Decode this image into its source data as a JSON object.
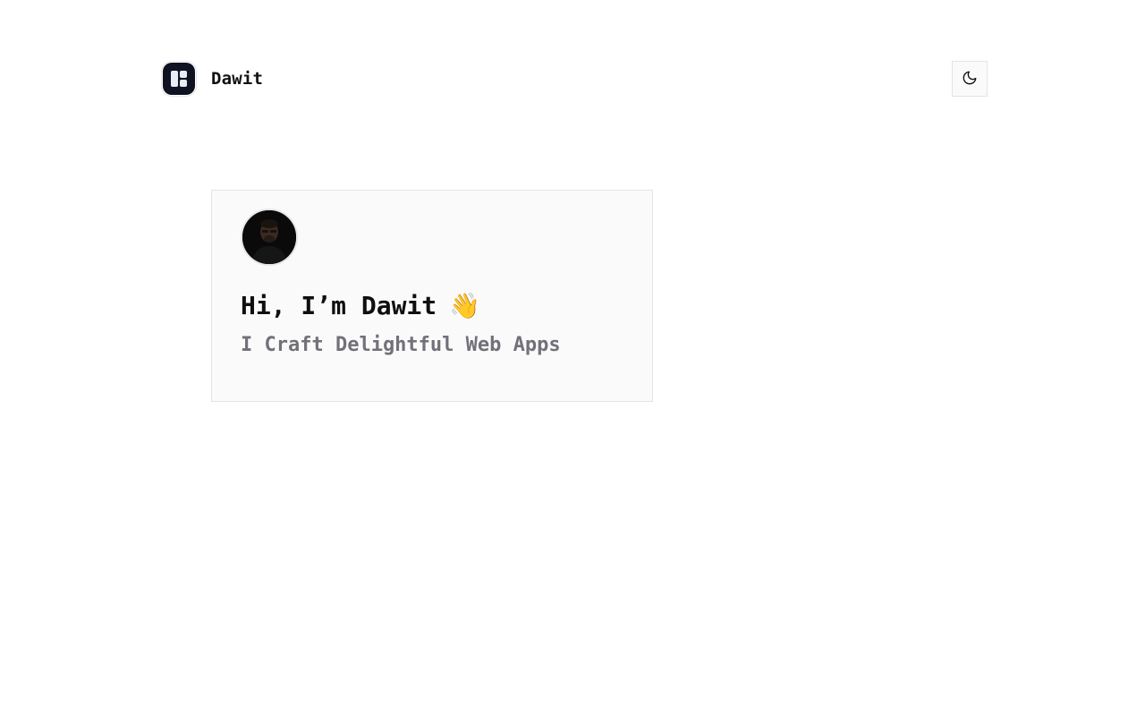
{
  "header": {
    "brand_name": "Dawit",
    "logo_icon": "layout-grid-icon",
    "theme_toggle_icon": "moon-icon"
  },
  "intro_card": {
    "avatar_alt": "Dawit",
    "greeting": "Hi, I’m Dawit",
    "greeting_emoji": "👋",
    "tagline": "I Craft Delightful Web Apps"
  },
  "colors": {
    "background": "#ffffff",
    "card_background": "#fafafa",
    "border": "#e4e4e7",
    "logo_background": "#0e1223",
    "heading_text": "#0f0f10",
    "muted_text": "#71717a"
  }
}
